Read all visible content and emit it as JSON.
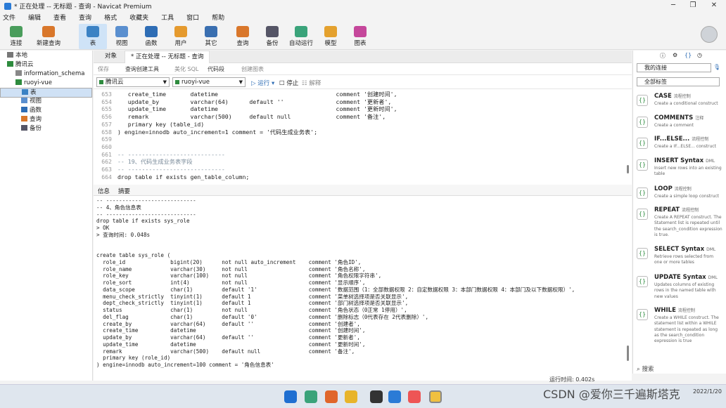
{
  "window": {
    "title": "* 正在处理 -- 无标题 - 查询 - Navicat Premium"
  },
  "menu": [
    "文件",
    "编辑",
    "查看",
    "查询",
    "格式",
    "收藏夹",
    "工具",
    "窗口",
    "帮助"
  ],
  "toolbar": {
    "connect": "连接",
    "new_query": "新建查询",
    "table": "表",
    "view": "视图",
    "function": "函数",
    "user": "用户",
    "other": "其它",
    "query": "查询",
    "backup": "备份",
    "auto_run": "自动运行",
    "model": "模型",
    "chart": "图表"
  },
  "tree": {
    "local": "本地",
    "cloud": "腾讯云",
    "info_schema": "information_schema",
    "db": "ruoyi-vue",
    "tables": "表",
    "views": "视图",
    "functions": "函数",
    "queries": "查询",
    "backups": "备份"
  },
  "tabs": {
    "objects": "对象",
    "current": "* 正在处理 -- 无标题 - 查询"
  },
  "subtoolbar": {
    "save": "保存",
    "builder": "查询创建工具",
    "beautify": "美化 SQL",
    "snippet": "代码段",
    "create_chart": "创建图表"
  },
  "selectors": {
    "connection": "腾讯云",
    "database": "ruoyi-vue",
    "run": "运行",
    "stop": "停止",
    "explain": "解释"
  },
  "editor_lines": [
    {
      "n": "653",
      "c": "   create_time       datetime                                  comment '创建时间',"
    },
    {
      "n": "654",
      "c": "   update_by         varchar(64)      default ''               comment '更新者',"
    },
    {
      "n": "655",
      "c": "   update_time       datetime                                  comment '更新时间',"
    },
    {
      "n": "656",
      "c": "   remark            varchar(500)     default null             comment '备注',"
    },
    {
      "n": "657",
      "c": "   primary key (table_id)"
    },
    {
      "n": "658",
      "c": ") engine=innodb auto_increment=1 comment = '代码生成业务表';"
    },
    {
      "n": "659",
      "c": ""
    },
    {
      "n": "660",
      "c": ""
    },
    {
      "n": "661",
      "c": "-- ----------------------------"
    },
    {
      "n": "662",
      "c": "-- 19、代码生成业务表字段"
    },
    {
      "n": "663",
      "c": "-- ----------------------------"
    },
    {
      "n": "664",
      "c": "drop table if exists gen_table_column;"
    }
  ],
  "info_tabs": {
    "info": "信息",
    "summary": "摘要"
  },
  "output_lines": [
    "-- ----------------------------",
    "-- 4、角色信息表",
    "-- ----------------------------",
    "drop table if exists sys_role",
    "> OK",
    "> 查询时间: 0.048s",
    "",
    "",
    "create table sys_role (",
    "  role_id              bigint(20)      not null auto_increment    comment '角色ID',",
    "  role_name            varchar(30)     not null                   comment '角色名称',",
    "  role_key             varchar(100)    not null                   comment '角色权限字符串',",
    "  role_sort            int(4)          not null                   comment '显示顺序',",
    "  data_scope           char(1)         default '1'                comment '数据范围（1：全部数据权限 2：自定数据权限 3：本部门数据权限 4：本部门及以下数据权限）',",
    "  menu_check_strictly  tinyint(1)      default 1                  comment '菜单树选择项是否关联显示',",
    "  dept_check_strictly  tinyint(1)      default 1                  comment '部门树选择项是否关联显示',",
    "  status               char(1)         not null                   comment '角色状态（0正常 1停用）',",
    "  del_flag             char(1)         default '0'                comment '删除标志（0代表存在 2代表删除）',",
    "  create_by            varchar(64)     default ''                 comment '创建者',",
    "  create_time          datetime                                   comment '创建时间',",
    "  update_by            varchar(64)     default ''                 comment '更新者',",
    "  update_time          datetime                                   comment '更新时间',",
    "  remark               varchar(500)    default null               comment '备注',",
    "  primary key (role_id)",
    ") engine=innodb auto_increment=100 comment = '角色信息表'"
  ],
  "status": {
    "runtime": "运行时间: 0.402s"
  },
  "right": {
    "connection_dd": "我的连接",
    "tag_dd": "全部标签",
    "search": "搜索"
  },
  "snippets": [
    {
      "title": "CASE",
      "tag": "流程控制",
      "desc": "Create a conditional construct"
    },
    {
      "title": "COMMENTS",
      "tag": "注释",
      "desc": "Create a comment"
    },
    {
      "title": "IF...ELSE...",
      "tag": "流程控制",
      "desc": "Create a IF...ELSE... construct"
    },
    {
      "title": "INSERT Syntax",
      "tag": "DML",
      "desc": "Insert new rows into an existing table"
    },
    {
      "title": "LOOP",
      "tag": "流程控制",
      "desc": "Create a simple loop construct"
    },
    {
      "title": "REPEAT",
      "tag": "流程控制",
      "desc": "Create A REPEAT construct. The Statement list is repeated until the search_condition expression is true."
    },
    {
      "title": "SELECT Syntax",
      "tag": "DML",
      "desc": "Retrieve rows selected from one or more tables"
    },
    {
      "title": "UPDATE Syntax",
      "tag": "DML",
      "desc": "Updates columns of existing rows in the named table with new values"
    },
    {
      "title": "WHILE",
      "tag": "流程控制",
      "desc": "Create a WHILE construct. The statement list within a WHILE statement is repeated as long as the search_condition expression is true"
    }
  ],
  "watermark": "CSDN @爱你三千遍斯塔克",
  "clock": {
    "time": "",
    "date": "2022/1/20"
  }
}
